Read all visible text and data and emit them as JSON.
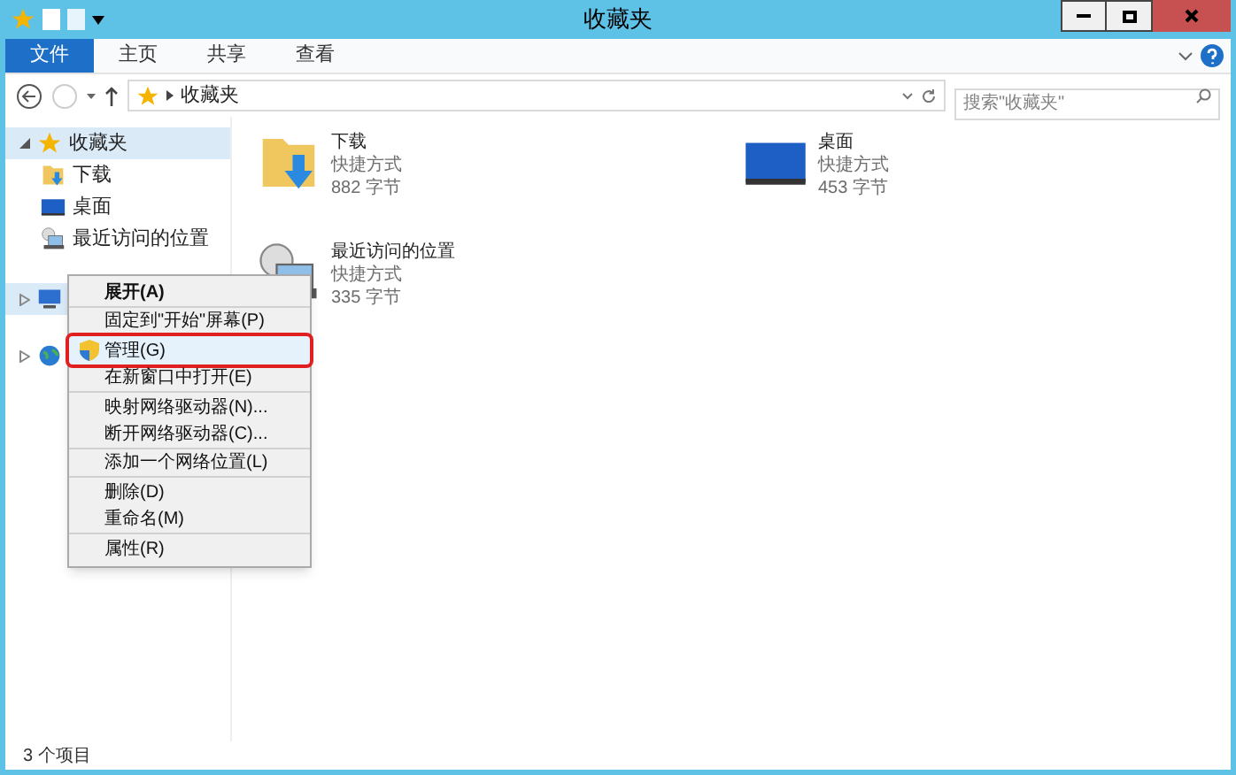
{
  "window": {
    "title": "收藏夹"
  },
  "ribbon": {
    "tabs": [
      {
        "label": "文件",
        "selected": true
      },
      {
        "label": "主页",
        "selected": false
      },
      {
        "label": "共享",
        "selected": false
      },
      {
        "label": "查看",
        "selected": false
      }
    ]
  },
  "address": {
    "path": "收藏夹",
    "search_placeholder": "搜索\"收藏夹\""
  },
  "sidebar": {
    "items": [
      {
        "label": "收藏夹",
        "expanded": true,
        "selected": true,
        "children": [
          {
            "label": "下载",
            "selected": false
          },
          {
            "label": "桌面",
            "selected": false
          },
          {
            "label": "最近访问的位置",
            "selected": false
          }
        ]
      },
      {
        "expanded": false,
        "selected": true
      },
      {
        "expanded": false,
        "selected": false
      }
    ]
  },
  "files": [
    {
      "name": "下载",
      "type": "快捷方式",
      "size": "882 字节"
    },
    {
      "name": "桌面",
      "type": "快捷方式",
      "size": "453 字节"
    },
    {
      "name": "最近访问的位置",
      "type": "快捷方式",
      "size": "335 字节"
    }
  ],
  "context_menu": {
    "items": [
      {
        "label": "展开(A)",
        "bold": true,
        "divider_after": true,
        "highlighted": false
      },
      {
        "label": "固定到\"开始\"屏幕(P)",
        "bold": false,
        "divider_after": true,
        "highlighted": false
      },
      {
        "label": "管理(G)",
        "bold": false,
        "divider_after": false,
        "highlighted": true,
        "shield": true
      },
      {
        "label": "在新窗口中打开(E)",
        "bold": false,
        "divider_after": true,
        "highlighted": false
      },
      {
        "label": "映射网络驱动器(N)...",
        "bold": false,
        "divider_after": false,
        "highlighted": false
      },
      {
        "label": "断开网络驱动器(C)...",
        "bold": false,
        "divider_after": true,
        "highlighted": false
      },
      {
        "label": "添加一个网络位置(L)",
        "bold": false,
        "divider_after": true,
        "highlighted": false
      },
      {
        "label": "删除(D)",
        "bold": false,
        "divider_after": false,
        "highlighted": false
      },
      {
        "label": "重命名(M)",
        "bold": false,
        "divider_after": true,
        "highlighted": false
      },
      {
        "label": "属性(R)",
        "bold": false,
        "divider_after": false,
        "highlighted": false
      }
    ]
  },
  "status_bar": {
    "text": "3 个项目"
  }
}
